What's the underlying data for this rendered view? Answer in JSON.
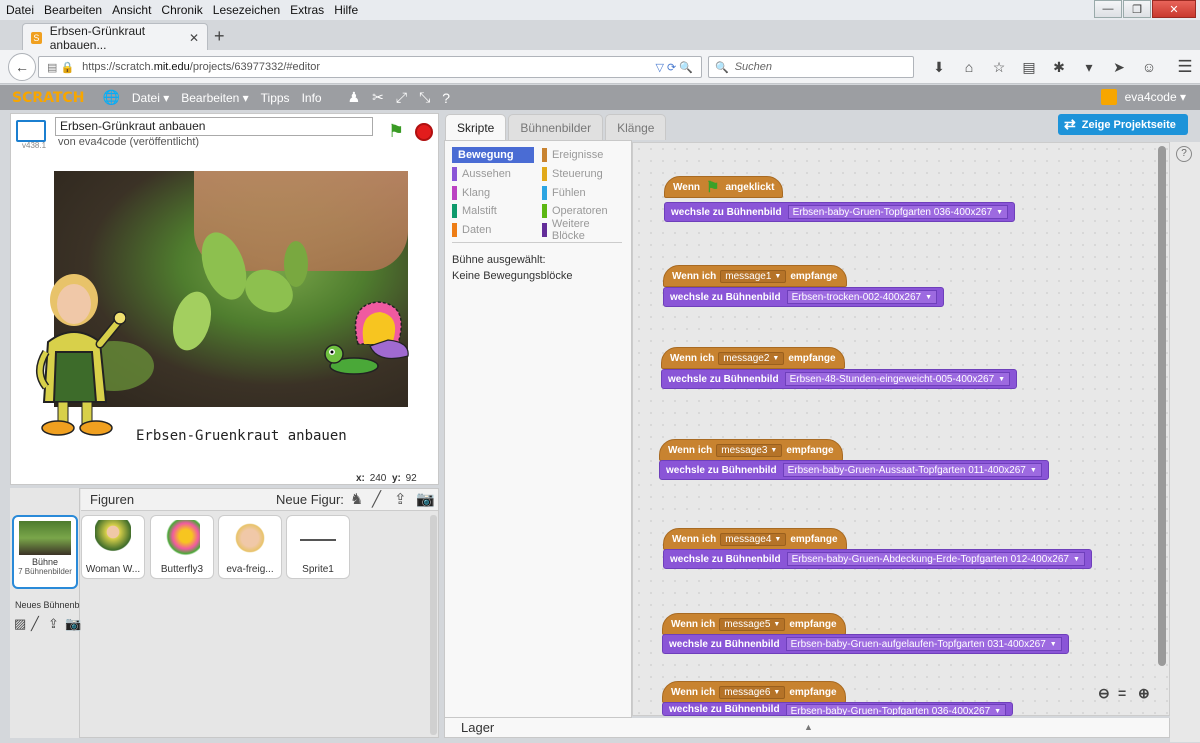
{
  "menubar": [
    "Datei",
    "Bearbeiten",
    "Ansicht",
    "Chronik",
    "Lesezeichen",
    "Extras",
    "Hilfe"
  ],
  "browser": {
    "tab_title": "Erbsen-Grünkraut anbauen...",
    "url_prefix": "https://scratch.",
    "url_host": "mit.edu",
    "url_path": "/projects/63977332/#editor",
    "search_placeholder": "Suchen"
  },
  "scratch": {
    "logo": "SCRATCH",
    "menu": [
      "Datei ▾",
      "Bearbeiten ▾",
      "Tipps",
      "Info"
    ],
    "user": "eva4code ▾"
  },
  "project": {
    "version": "v438.1",
    "title": "Erbsen-Grünkraut anbauen",
    "author": "von eva4code (veröffentlicht)",
    "stage_label": "Erbsen-Gruenkraut anbauen",
    "x_label": "x:",
    "x": "240",
    "y_label": "y:",
    "y": "92"
  },
  "sprites": {
    "header": "Figuren",
    "new_figure": "Neue Figur:",
    "stage_name": "Bühne",
    "stage_count": "7 Bühnenbilder",
    "new_backdrop": "Neues Bühnenb",
    "items": [
      "Woman W...",
      "Butterfly3",
      "eva-freig...",
      "Sprite1"
    ]
  },
  "editor": {
    "tabs": [
      "Skripte",
      "Bühnenbilder",
      "Klänge"
    ],
    "show_project": "Zeige Projektseite",
    "categories_left": [
      "Bewegung",
      "Aussehen",
      "Klang",
      "Malstift",
      "Daten"
    ],
    "categories_right": [
      "Ereignisse",
      "Steuerung",
      "Fühlen",
      "Operatoren",
      "Weitere Blöcke"
    ],
    "palette_msg1": "Bühne ausgewählt:",
    "palette_msg2": "Keine Bewegungsblöcke",
    "lager": "Lager"
  },
  "blocks": {
    "wenn": "Wenn",
    "angeklickt": "angeklickt",
    "wenn_ich": "Wenn ich",
    "empfange": "empfange",
    "wechsle": "wechsle zu Bühnenbild",
    "scripts": [
      {
        "msg": "",
        "backdrop": "Erbsen-baby-Gruen-Topfgarten 036-400x267"
      },
      {
        "msg": "message1",
        "backdrop": "Erbsen-trocken-002-400x267"
      },
      {
        "msg": "message2",
        "backdrop": "Erbsen-48-Stunden-eingeweicht-005-400x267"
      },
      {
        "msg": "message3",
        "backdrop": "Erbsen-baby-Gruen-Aussaat-Topfgarten 011-400x267"
      },
      {
        "msg": "message4",
        "backdrop": "Erbsen-baby-Gruen-Abdeckung-Erde-Topfgarten 012-400x267"
      },
      {
        "msg": "message5",
        "backdrop": "Erbsen-baby-Gruen-aufgelaufen-Topfgarten 031-400x267"
      },
      {
        "msg": "message6",
        "backdrop": "Erbsen-baby-Gruen-Topfgarten 036-400x267"
      }
    ]
  },
  "colors": {
    "motion": "#4a6cd4",
    "looks": "#8a55d7",
    "events": "#c88330",
    "accent": "#1d93d9"
  }
}
